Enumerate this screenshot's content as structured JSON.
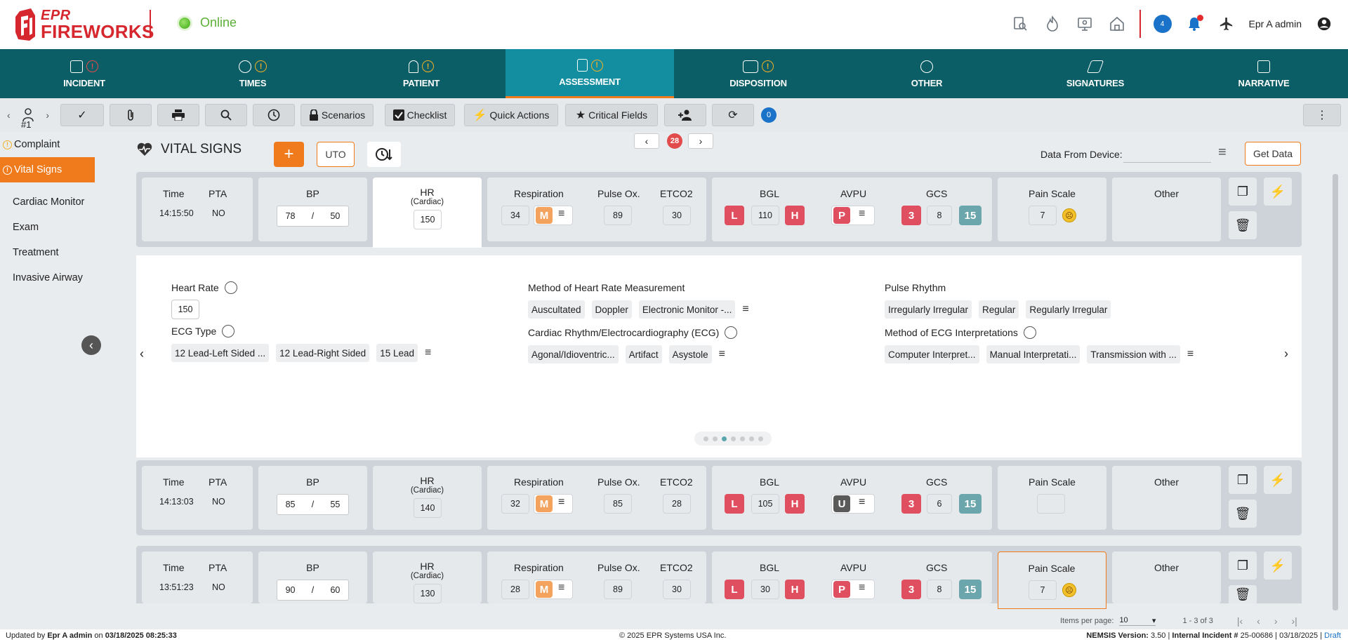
{
  "header": {
    "logo_line1": "EPR",
    "logo_line2": "FIREWORKS",
    "status": "Online",
    "chat_count": "4",
    "user": "Epr A admin"
  },
  "nav": [
    {
      "label": "INCIDENT",
      "warn": "red"
    },
    {
      "label": "TIMES",
      "warn": "yellow"
    },
    {
      "label": "PATIENT",
      "warn": "yellow"
    },
    {
      "label": "ASSESSMENT",
      "warn": "yellow",
      "active": true
    },
    {
      "label": "DISPOSITION",
      "warn": "yellow"
    },
    {
      "label": "OTHER"
    },
    {
      "label": "SIGNATURES"
    },
    {
      "label": "NARRATIVE"
    }
  ],
  "toolbar": {
    "patient_num": "#1",
    "scenarios": "Scenarios",
    "checklist": "Checklist",
    "quick_actions": "Quick Actions",
    "critical_fields": "Critical Fields",
    "notif_count": "0"
  },
  "sidebar": {
    "complaint": "Complaint",
    "vital_signs": "Vital Signs",
    "cardiac_monitor": "Cardiac Monitor",
    "exam": "Exam",
    "treatment": "Treatment",
    "invasive_airway": "Invasive Airway"
  },
  "main": {
    "title": "VITAL SIGNS",
    "add": "+",
    "uto": "UTO",
    "pager_count": "28",
    "data_from_device": "Data From Device:",
    "get_data": "Get Data"
  },
  "labels": {
    "time": "Time",
    "pta": "PTA",
    "bp": "BP",
    "hr": "HR",
    "hr_sub": "(Cardiac)",
    "respiration": "Respiration",
    "pulse_ox": "Pulse Ox.",
    "etco2": "ETCO2",
    "bgl": "BGL",
    "avpu": "AVPU",
    "gcs": "GCS",
    "pain_scale": "Pain Scale",
    "other": "Other",
    "sep": "/",
    "L": "L",
    "H": "H",
    "M": "M"
  },
  "rows": [
    {
      "time": "14:15:50",
      "pta": "NO",
      "bp_sys": "78",
      "bp_dia": "50",
      "hr": "150",
      "resp": "34",
      "resp_q": "M",
      "pulse_ox": "89",
      "etco2": "30",
      "bgl": "110",
      "avpu": "P",
      "gcs_e": "3",
      "gcs_v": "8",
      "gcs_total": "15",
      "pain": "7"
    },
    {
      "time": "14:13:03",
      "pta": "NO",
      "bp_sys": "85",
      "bp_dia": "55",
      "hr": "140",
      "resp": "32",
      "resp_q": "M",
      "pulse_ox": "85",
      "etco2": "28",
      "bgl": "105",
      "avpu": "U",
      "gcs_e": "3",
      "gcs_v": "6",
      "gcs_total": "15",
      "pain": ""
    },
    {
      "time": "13:51:23",
      "pta": "NO",
      "bp_sys": "90",
      "bp_dia": "60",
      "hr": "130",
      "resp": "28",
      "resp_q": "M",
      "pulse_ox": "89",
      "etco2": "30",
      "bgl": "30",
      "avpu": "P",
      "gcs_e": "3",
      "gcs_v": "8",
      "gcs_total": "15",
      "pain": "7"
    }
  ],
  "detail": {
    "heart_rate_label": "Heart Rate",
    "heart_rate_value": "150",
    "ecg_type_label": "ECG Type",
    "ecg_type_opts": [
      "12 Lead-Left Sided ...",
      "12 Lead-Right Sided",
      "15 Lead"
    ],
    "method_hr_label": "Method of Heart Rate Measurement",
    "method_hr_opts": [
      "Auscultated",
      "Doppler",
      "Electronic Monitor -..."
    ],
    "cardiac_rhythm_label": "Cardiac Rhythm/Electrocardiography (ECG)",
    "cardiac_rhythm_opts": [
      "Agonal/Idioventric...",
      "Artifact",
      "Asystole"
    ],
    "pulse_rhythm_label": "Pulse Rhythm",
    "pulse_rhythm_opts": [
      "Irregularly Irregular",
      "Regular",
      "Regularly Irregular"
    ],
    "method_ecg_label": "Method of ECG Interpretations",
    "method_ecg_opts": [
      "Computer Interpret...",
      "Manual Interpretati...",
      "Transmission with ..."
    ],
    "carousel_pages": 7,
    "carousel_active_page": 3
  },
  "pagination": {
    "items_per_page_label": "Items per page:",
    "items_per_page": "10",
    "range": "1 - 3 of 3"
  },
  "footer": {
    "updated_by_prefix": "Updated by",
    "updated_by_user": "Epr A admin",
    "updated_on_prefix": "on",
    "updated_on": "03/18/2025 08:25:33",
    "copyright": "© 2025 EPR Systems USA Inc.",
    "nemsis_label": "NEMSIS Version:",
    "nemsis_version": "3.50",
    "incident_label": "Internal Incident #",
    "incident_num": "25-00686",
    "incident_date": "03/18/2025",
    "status": "Draft"
  }
}
